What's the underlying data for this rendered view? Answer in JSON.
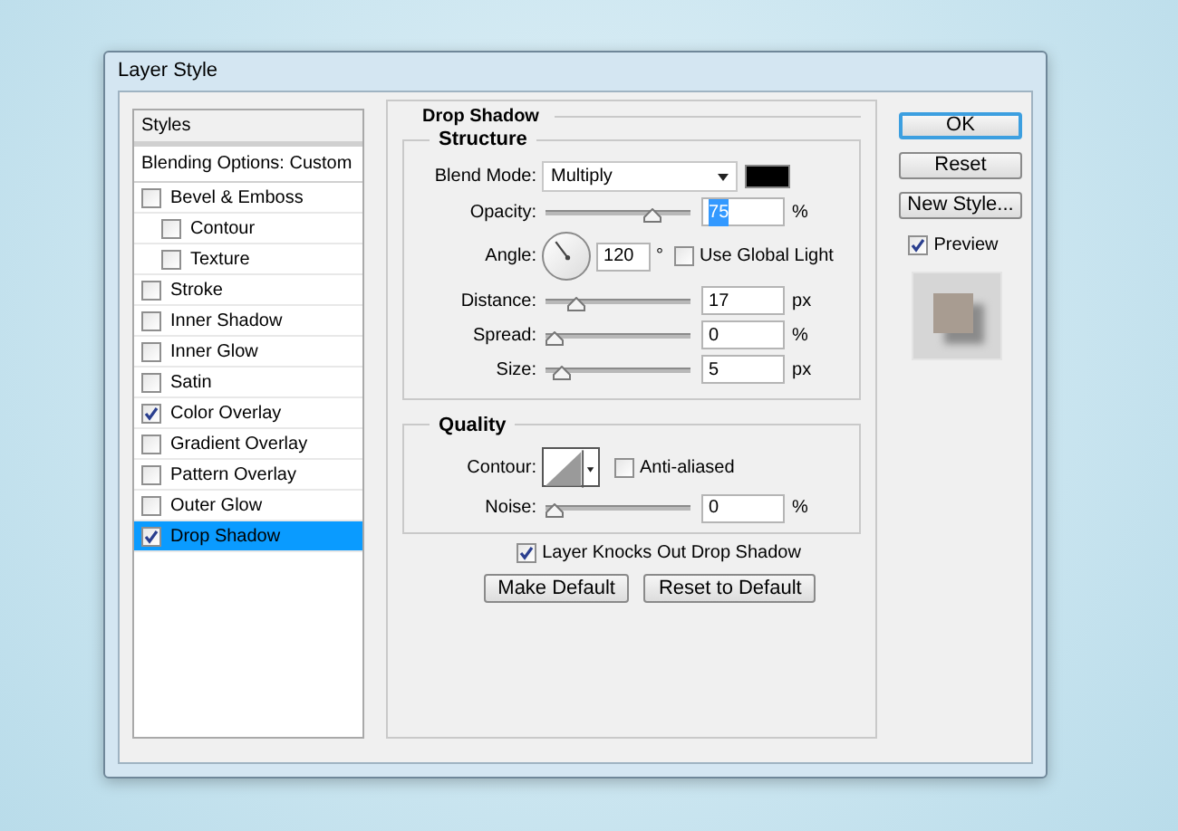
{
  "window": {
    "title": "Layer Style"
  },
  "styles_panel": {
    "header": "Styles",
    "blending_options": "Blending Options: Custom",
    "items": [
      {
        "label": "Bevel & Emboss",
        "checked": false,
        "selected": false,
        "children": [
          {
            "label": "Contour",
            "checked": false,
            "selected": false
          },
          {
            "label": "Texture",
            "checked": false,
            "selected": false
          }
        ]
      },
      {
        "label": "Stroke",
        "checked": false,
        "selected": false
      },
      {
        "label": "Inner Shadow",
        "checked": false,
        "selected": false
      },
      {
        "label": "Inner Glow",
        "checked": false,
        "selected": false
      },
      {
        "label": "Satin",
        "checked": false,
        "selected": false
      },
      {
        "label": "Color Overlay",
        "checked": true,
        "selected": false
      },
      {
        "label": "Gradient Overlay",
        "checked": false,
        "selected": false
      },
      {
        "label": "Pattern Overlay",
        "checked": false,
        "selected": false
      },
      {
        "label": "Outer Glow",
        "checked": false,
        "selected": false
      },
      {
        "label": "Drop Shadow",
        "checked": true,
        "selected": true
      }
    ]
  },
  "drop_shadow": {
    "title": "Drop Shadow",
    "structure": {
      "title": "Structure",
      "blend_mode": {
        "label": "Blend Mode:",
        "value": "Multiply"
      },
      "rows": [
        {
          "kind": "slider",
          "label": "Opacity:",
          "level": 0.75,
          "value": "75",
          "unit": "%",
          "value_selected": true
        },
        {
          "kind": "angle",
          "label": "Angle:",
          "value": "120",
          "unit": "°",
          "option": {
            "label": "Use Global Light",
            "checked": false
          }
        },
        {
          "kind": "slider",
          "label": "Distance:",
          "level": 0.17,
          "value": "17",
          "unit": "px",
          "value_selected": false
        },
        {
          "kind": "slider",
          "label": "Spread:",
          "level": 0,
          "value": "0",
          "unit": "%",
          "value_selected": false
        },
        {
          "kind": "slider",
          "label": "Size:",
          "level": 0.05,
          "value": "5",
          "unit": "px",
          "value_selected": false
        }
      ]
    },
    "quality": {
      "title": "Quality",
      "contour": {
        "label": "Contour:"
      },
      "anti_aliased": {
        "label": "Anti-aliased",
        "checked": false
      },
      "rows": [
        {
          "kind": "slider",
          "label": "Noise:",
          "level": 0,
          "value": "0",
          "unit": "%",
          "value_selected": false
        }
      ]
    },
    "knockout": {
      "label": "Layer Knocks Out Drop Shadow",
      "checked": true
    },
    "buttons": [
      "Make Default",
      "Reset to Default"
    ]
  },
  "side": {
    "buttons": [
      {
        "label": "OK",
        "default": true
      },
      {
        "label": "Reset",
        "default": false
      },
      {
        "label": "New Style...",
        "default": false
      }
    ],
    "preview": {
      "label": "Preview",
      "checked": true
    }
  }
}
